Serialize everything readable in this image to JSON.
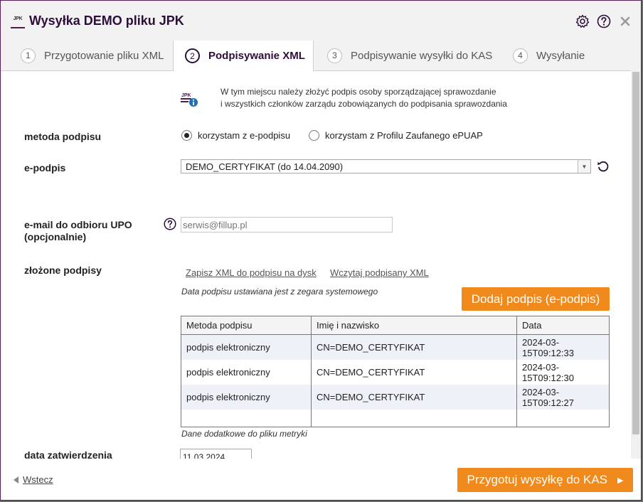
{
  "window": {
    "logo_text": "JPK",
    "title": "Wysyłka DEMO pliku JPK"
  },
  "tabs": [
    {
      "num": "1",
      "label": "Przygotowanie pliku XML"
    },
    {
      "num": "2",
      "label": "Podpisywanie XML"
    },
    {
      "num": "3",
      "label": "Podpisywanie wysyłki do KAS"
    },
    {
      "num": "4",
      "label": "Wysyłanie"
    }
  ],
  "info": {
    "icon_text": "JPK",
    "line1": "W tym miejscu należy złożyć podpis osoby sporządzającej sprawozdanie",
    "line2": "i wszystkich członków zarządu zobowiązanych do podpisania sprawozdania"
  },
  "form": {
    "method_label": "metoda podpisu",
    "method_option1": "korzystam z e-podpisu",
    "method_option2": "korzystam z Profilu Zaufanego ePUAP",
    "esign_label": "e-podpis",
    "esign_value": "DEMO_CERTYFIKAT (do 14.04.2090)",
    "email_label_line1": "e-mail do odbioru UPO",
    "email_label_line2": "(opcjonalnie)",
    "email_placeholder": "serwis@fillup.pl",
    "signatures_label": "złożone podpisy",
    "save_link": "Zapisz XML do podpisu na dysk",
    "load_link": "Wczytaj podpisany XML",
    "clock_note": "Data podpisu ustawiana jest z zegara systemowego",
    "add_button": "Dodaj podpis (e-podpis)",
    "extra_note": "Dane dodatkowe do pliku metryki",
    "approval_label": "data zatwierdzenia",
    "approval_value": "11.03.2024"
  },
  "table": {
    "headers": [
      "Metoda podpisu",
      "Imię i nazwisko",
      "Data"
    ],
    "rows": [
      [
        "podpis elektroniczny",
        "CN=DEMO_CERTYFIKAT",
        "2024-03-15T09:12:33"
      ],
      [
        "podpis elektroniczny",
        "CN=DEMO_CERTYFIKAT",
        "2024-03-15T09:12:30"
      ],
      [
        "podpis elektroniczny",
        "CN=DEMO_CERTYFIKAT",
        "2024-03-15T09:12:27"
      ]
    ]
  },
  "footer": {
    "back_label": "Wstecz",
    "next_label": "Przygotuj wysyłkę do KAS"
  },
  "colors": {
    "accent": "#f08a1c",
    "brand": "#2d0f3a"
  }
}
